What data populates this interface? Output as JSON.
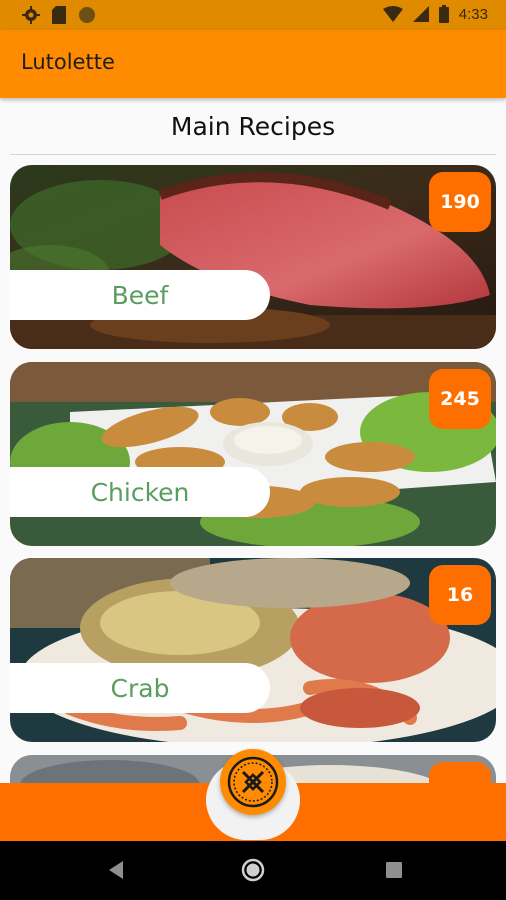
{
  "status_bar": {
    "time": "4:33",
    "left_icons": [
      "settings-icon",
      "sd-card-icon",
      "circle-icon"
    ],
    "right_icons": [
      "wifi-icon",
      "signal-icon",
      "battery-icon"
    ]
  },
  "app_bar": {
    "title": "Lutolette"
  },
  "section": {
    "title": "Main Recipes"
  },
  "cards": [
    {
      "label": "Beef",
      "count": "190"
    },
    {
      "label": "Chicken",
      "count": "245"
    },
    {
      "label": "Crab",
      "count": "16"
    },
    {
      "label": "",
      "count": ""
    }
  ],
  "fab": {
    "icon": "emblem-icon"
  },
  "colors": {
    "status_bar": "#e08a00",
    "app_bar": "#ff8c00",
    "badge": "#ff6f00",
    "label_text": "#5a9e5e",
    "bottom_bar": "#ff6f00"
  },
  "nav_bar": {
    "icons": [
      "back-icon",
      "home-icon",
      "recents-icon"
    ]
  }
}
